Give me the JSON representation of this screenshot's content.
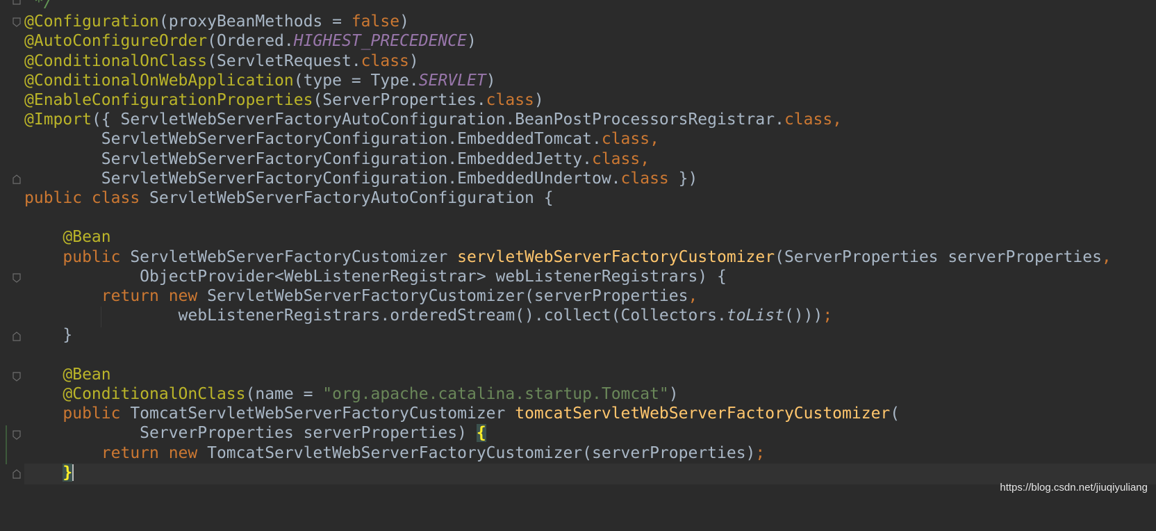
{
  "editor": {
    "lines": [
      {
        "tokens": [
          {
            "t": "*/",
            "c": "comment"
          }
        ],
        "indent": 1
      },
      {
        "tokens": [
          {
            "t": "@Configuration",
            "c": "ann"
          },
          {
            "t": "(proxyBeanMethods = ",
            "c": "param"
          },
          {
            "t": "false",
            "c": "kw"
          },
          {
            "t": ")",
            "c": "param"
          }
        ]
      },
      {
        "tokens": [
          {
            "t": "@AutoConfigureOrder",
            "c": "ann"
          },
          {
            "t": "(Ordered.",
            "c": "param"
          },
          {
            "t": "HIGHEST_PRECEDENCE",
            "c": "const"
          },
          {
            "t": ")",
            "c": "param"
          }
        ]
      },
      {
        "tokens": [
          {
            "t": "@ConditionalOnClass",
            "c": "ann"
          },
          {
            "t": "(ServletRequest.",
            "c": "param"
          },
          {
            "t": "class",
            "c": "kw"
          },
          {
            "t": ")",
            "c": "param"
          }
        ]
      },
      {
        "tokens": [
          {
            "t": "@ConditionalOnWebApplication",
            "c": "ann"
          },
          {
            "t": "(type = Type.",
            "c": "param"
          },
          {
            "t": "SERVLET",
            "c": "const"
          },
          {
            "t": ")",
            "c": "param"
          }
        ]
      },
      {
        "tokens": [
          {
            "t": "@EnableConfigurationProperties",
            "c": "ann"
          },
          {
            "t": "(ServerProperties.",
            "c": "param"
          },
          {
            "t": "class",
            "c": "kw"
          },
          {
            "t": ")",
            "c": "param"
          }
        ]
      },
      {
        "tokens": [
          {
            "t": "@Import",
            "c": "ann"
          },
          {
            "t": "({ ServletWebServerFactoryAutoConfiguration.BeanPostProcessorsRegistrar.",
            "c": "param"
          },
          {
            "t": "class,",
            "c": "kw"
          }
        ]
      },
      {
        "tokens": [
          {
            "t": "        ServletWebServerFactoryConfiguration.EmbeddedTomcat.",
            "c": "param"
          },
          {
            "t": "class,",
            "c": "kw"
          }
        ]
      },
      {
        "tokens": [
          {
            "t": "        ServletWebServerFactoryConfiguration.EmbeddedJetty.",
            "c": "param"
          },
          {
            "t": "class,",
            "c": "kw"
          }
        ]
      },
      {
        "tokens": [
          {
            "t": "        ServletWebServerFactoryConfiguration.EmbeddedUndertow.",
            "c": "param"
          },
          {
            "t": "class",
            "c": "kw"
          },
          {
            "t": " })",
            "c": "param"
          }
        ]
      },
      {
        "tokens": [
          {
            "t": "public class ",
            "c": "kw"
          },
          {
            "t": "ServletWebServerFactoryAutoConfiguration {",
            "c": "param"
          }
        ]
      },
      {
        "tokens": []
      },
      {
        "tokens": [
          {
            "t": "    @Bean",
            "c": "ann"
          }
        ]
      },
      {
        "tokens": [
          {
            "t": "    public ",
            "c": "kw"
          },
          {
            "t": "ServletWebServerFactoryCustomizer ",
            "c": "param"
          },
          {
            "t": "servletWebServerFactoryCustomizer",
            "c": "method"
          },
          {
            "t": "(ServerProperties serverProperties",
            "c": "param"
          },
          {
            "t": ",",
            "c": "kw"
          }
        ]
      },
      {
        "tokens": [
          {
            "t": "            ObjectProvider<WebListenerRegistrar> webListenerRegistrars) {",
            "c": "param"
          }
        ]
      },
      {
        "tokens": [
          {
            "t": "        return new ",
            "c": "kw"
          },
          {
            "t": "ServletWebServerFactoryCustomizer(serverProperties",
            "c": "param"
          },
          {
            "t": ",",
            "c": "kw"
          }
        ]
      },
      {
        "tokens": [
          {
            "t": "                webListenerRegistrars.orderedStream().collect(Collectors.",
            "c": "param"
          },
          {
            "t": "toList",
            "c": "italic"
          },
          {
            "t": "()))",
            "c": "param"
          },
          {
            "t": ";",
            "c": "kw"
          }
        ]
      },
      {
        "tokens": [
          {
            "t": "    }",
            "c": "param"
          }
        ]
      },
      {
        "tokens": []
      },
      {
        "tokens": [
          {
            "t": "    @Bean",
            "c": "ann"
          }
        ]
      },
      {
        "tokens": [
          {
            "t": "    @ConditionalOnClass",
            "c": "ann"
          },
          {
            "t": "(name = ",
            "c": "param"
          },
          {
            "t": "\"org.apache.catalina.startup.Tomcat\"",
            "c": "str"
          },
          {
            "t": ")",
            "c": "param"
          }
        ]
      },
      {
        "tokens": [
          {
            "t": "    public ",
            "c": "kw"
          },
          {
            "t": "TomcatServletWebServerFactoryCustomizer ",
            "c": "param"
          },
          {
            "t": "tomcatServletWebServerFactoryCustomizer",
            "c": "method"
          },
          {
            "t": "(",
            "c": "param"
          }
        ]
      },
      {
        "tokens": [
          {
            "t": "            ServerProperties serverProperties) ",
            "c": "param"
          },
          {
            "t": "{",
            "c": "brace-hl"
          }
        ]
      },
      {
        "tokens": [
          {
            "t": "        return new ",
            "c": "kw"
          },
          {
            "t": "TomcatServletWebServerFactoryCustomizer(serverProperties)",
            "c": "param"
          },
          {
            "t": ";",
            "c": "kw"
          }
        ]
      },
      {
        "tokens": [
          {
            "t": "    ",
            "c": "param"
          },
          {
            "t": "}",
            "c": "brace-hl"
          },
          {
            "t": "",
            "c": "caret"
          }
        ]
      }
    ]
  },
  "watermark": "https://blog.csdn.net/jiuqiyuliang"
}
